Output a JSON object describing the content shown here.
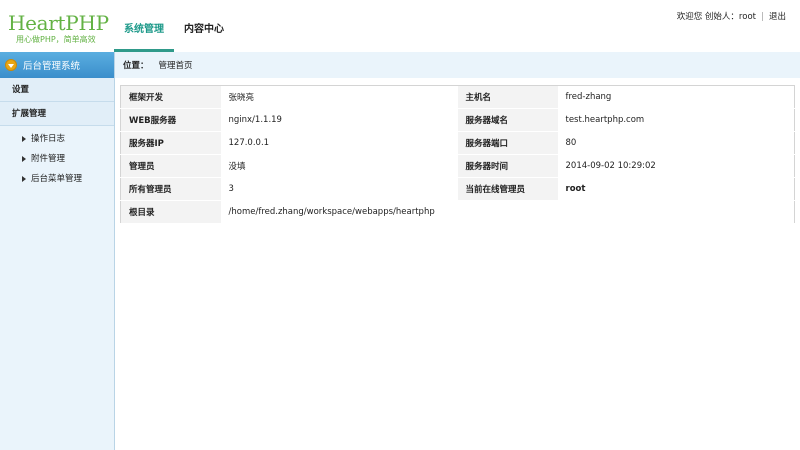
{
  "header": {
    "logo_title": "HeartPHP",
    "logo_subtitle": "用心做PHP，简单高效",
    "tabs": [
      {
        "label": "系统管理",
        "active": true
      },
      {
        "label": "内容中心",
        "active": false
      }
    ],
    "user": {
      "greeting": "欢迎您 创始人：root",
      "logout": "退出"
    }
  },
  "sidebar": {
    "title": "后台管理系统",
    "groups": [
      {
        "label": "设置"
      },
      {
        "label": "扩展管理"
      }
    ],
    "items": [
      {
        "label": "操作日志"
      },
      {
        "label": "附件管理"
      },
      {
        "label": "后台菜单管理"
      }
    ]
  },
  "breadcrumb": {
    "label": "位置：",
    "current": "管理首页"
  },
  "info": {
    "rows": [
      {
        "k1": "框架开发",
        "v1": "张晓亮",
        "k2": "主机名",
        "v2": "fred-zhang"
      },
      {
        "k1": "WEB服务器",
        "v1": "nginx/1.1.19",
        "k2": "服务器域名",
        "v2": "test.heartphp.com"
      },
      {
        "k1": "服务器IP",
        "v1": "127.0.0.1",
        "k2": "服务器端口",
        "v2": "80"
      },
      {
        "k1": "管理员",
        "v1": "没填",
        "k2": "服务器时间",
        "v2": "2014-09-02 10:29:02"
      },
      {
        "k1": "所有管理员",
        "v1": "3",
        "k2": "当前在线管理员",
        "v2": "root"
      }
    ],
    "root_dir_label": "根目录",
    "root_dir_value": "/home/fred.zhang/workspace/webapps/heartphp"
  },
  "colors": {
    "brand_green": "#63b244",
    "active_tab": "#1e9a8a",
    "sidebar_head": "#3b8ecb",
    "sidebar_bg": "#eaf4fb"
  }
}
